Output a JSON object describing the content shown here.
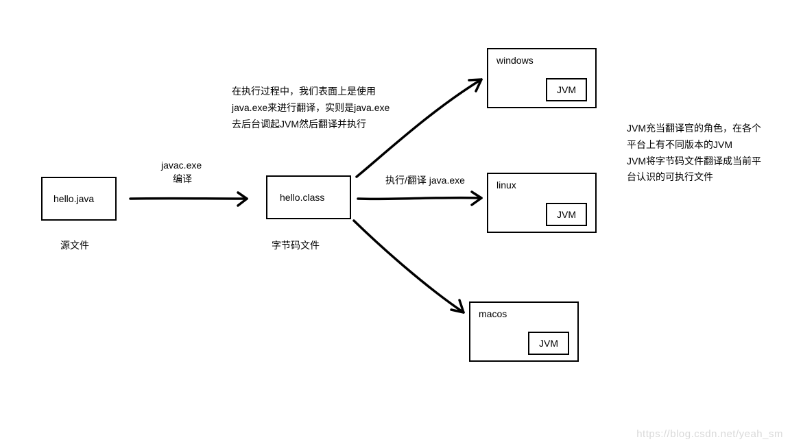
{
  "source_box": {
    "label": "hello.java",
    "caption": "源文件"
  },
  "compile_step": {
    "tool": "javac.exe",
    "action": "编译"
  },
  "bytecode_box": {
    "label": "hello.class",
    "caption": "字节码文件"
  },
  "exec_note": {
    "line1": "在执行过程中，我们表面上是使用",
    "line2": "java.exe来进行翻译，实则是java.exe",
    "line3": "去后台调起JVM然后翻译并执行"
  },
  "exec_label": "执行/翻译 java.exe",
  "platforms": {
    "windows": {
      "name": "windows",
      "vm": "JVM"
    },
    "linux": {
      "name": "linux",
      "vm": "JVM"
    },
    "macos": {
      "name": "macos",
      "vm": "JVM"
    }
  },
  "jvm_note": {
    "line1": "JVM充当翻译官的角色，在各个",
    "line2": "平台上有不同版本的JVM",
    "line3": "JVM将字节码文件翻译成当前平",
    "line4": "台认识的可执行文件"
  },
  "watermark": "https://blog.csdn.net/yeah_sm"
}
